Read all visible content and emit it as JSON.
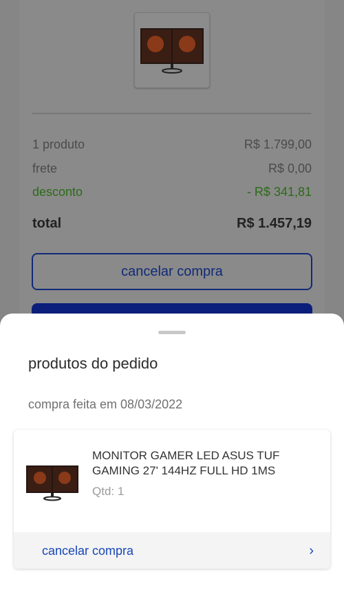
{
  "summary": {
    "products_label": "1 produto",
    "products_value": "R$ 1.799,00",
    "shipping_label": "frete",
    "shipping_value": "R$ 0,00",
    "discount_label": "desconto",
    "discount_value": "- R$ 341,81",
    "total_label": "total",
    "total_value": "R$ 1.457,19",
    "cancel_button": "cancelar compra"
  },
  "sheet": {
    "title": "produtos do pedido",
    "date_text": "compra feita em 08/03/2022",
    "product": {
      "name": "MONITOR GAMER LED ASUS TUF GAMING 27' 144HZ FULL HD 1MS",
      "qty": "Qtd: 1"
    },
    "footer_link": "cancelar compra"
  },
  "colors": {
    "accent_blue": "#0a1e7a",
    "link_blue": "#1846b8",
    "discount_green": "#2c6b18"
  },
  "icons": {
    "chevron": "chevron-right-icon"
  }
}
